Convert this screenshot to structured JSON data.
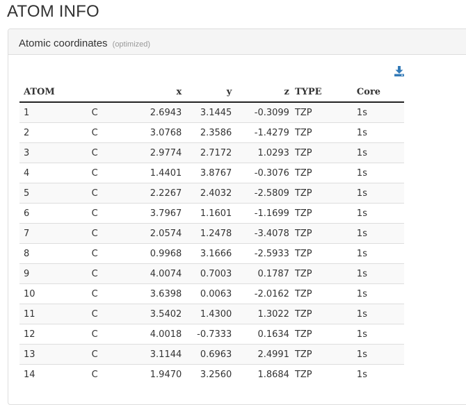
{
  "page": {
    "title": "ATOM INFO"
  },
  "panel": {
    "title": "Atomic coordinates",
    "subtitle": "(optimized)"
  },
  "icons": {
    "download": "download-icon"
  },
  "colors": {
    "accent": "#337ab7",
    "header_rule": "#222222",
    "stripe": "#f9f9f9"
  },
  "table": {
    "headers": {
      "atom": "ATOM",
      "x": "x",
      "y": "y",
      "z": "z",
      "type": "TYPE",
      "core": "Core"
    },
    "rows": [
      {
        "atom": "1",
        "element": "C",
        "x": "2.6943",
        "y": "3.1445",
        "z": "-0.3099",
        "type": "TZP",
        "core": "1s"
      },
      {
        "atom": "2",
        "element": "C",
        "x": "3.0768",
        "y": "2.3586",
        "z": "-1.4279",
        "type": "TZP",
        "core": "1s"
      },
      {
        "atom": "3",
        "element": "C",
        "x": "2.9774",
        "y": "2.7172",
        "z": "1.0293",
        "type": "TZP",
        "core": "1s"
      },
      {
        "atom": "4",
        "element": "C",
        "x": "1.4401",
        "y": "3.8767",
        "z": "-0.3076",
        "type": "TZP",
        "core": "1s"
      },
      {
        "atom": "5",
        "element": "C",
        "x": "2.2267",
        "y": "2.4032",
        "z": "-2.5809",
        "type": "TZP",
        "core": "1s"
      },
      {
        "atom": "6",
        "element": "C",
        "x": "3.7967",
        "y": "1.1601",
        "z": "-1.1699",
        "type": "TZP",
        "core": "1s"
      },
      {
        "atom": "7",
        "element": "C",
        "x": "2.0574",
        "y": "1.2478",
        "z": "-3.4078",
        "type": "TZP",
        "core": "1s"
      },
      {
        "atom": "8",
        "element": "C",
        "x": "0.9968",
        "y": "3.1666",
        "z": "-2.5933",
        "type": "TZP",
        "core": "1s"
      },
      {
        "atom": "9",
        "element": "C",
        "x": "4.0074",
        "y": "0.7003",
        "z": "0.1787",
        "type": "TZP",
        "core": "1s"
      },
      {
        "atom": "10",
        "element": "C",
        "x": "3.6398",
        "y": "0.0063",
        "z": "-2.0162",
        "type": "TZP",
        "core": "1s"
      },
      {
        "atom": "11",
        "element": "C",
        "x": "3.5402",
        "y": "1.4300",
        "z": "1.3022",
        "type": "TZP",
        "core": "1s"
      },
      {
        "atom": "12",
        "element": "C",
        "x": "4.0018",
        "y": "-0.7333",
        "z": "0.1634",
        "type": "TZP",
        "core": "1s"
      },
      {
        "atom": "13",
        "element": "C",
        "x": "3.1144",
        "y": "0.6963",
        "z": "2.4991",
        "type": "TZP",
        "core": "1s"
      },
      {
        "atom": "14",
        "element": "C",
        "x": "1.9470",
        "y": "3.2560",
        "z": "1.8684",
        "type": "TZP",
        "core": "1s"
      }
    ]
  }
}
